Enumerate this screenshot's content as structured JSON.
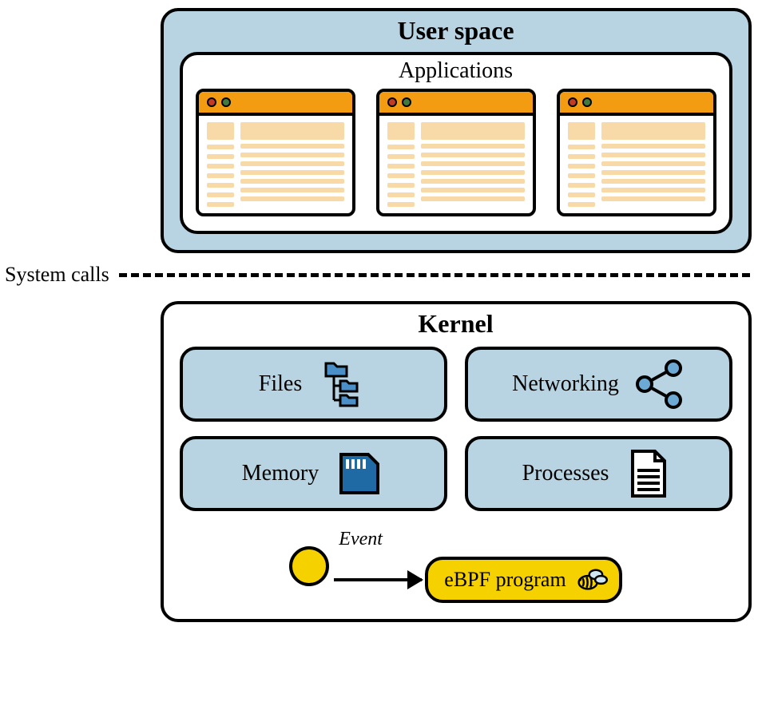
{
  "userspace": {
    "title": "User space",
    "applications_label": "Applications"
  },
  "boundary": {
    "label": "System calls"
  },
  "kernel": {
    "title": "Kernel",
    "subsystems": {
      "files": "Files",
      "networking": "Networking",
      "memory": "Memory",
      "processes": "Processes"
    },
    "event_label": "Event",
    "ebpf_label": "eBPF program"
  },
  "icons": {
    "files": "folder-tree-icon",
    "networking": "share-nodes-icon",
    "memory": "memory-card-icon",
    "processes": "document-lines-icon",
    "ebpf": "bee-icon"
  },
  "colors": {
    "panel_blue": "#b8d4e3",
    "titlebar_orange": "#f39c12",
    "content_peach": "#f8d9a8",
    "accent_yellow": "#f5d100",
    "memory_icon_blue": "#1f6aa5"
  }
}
